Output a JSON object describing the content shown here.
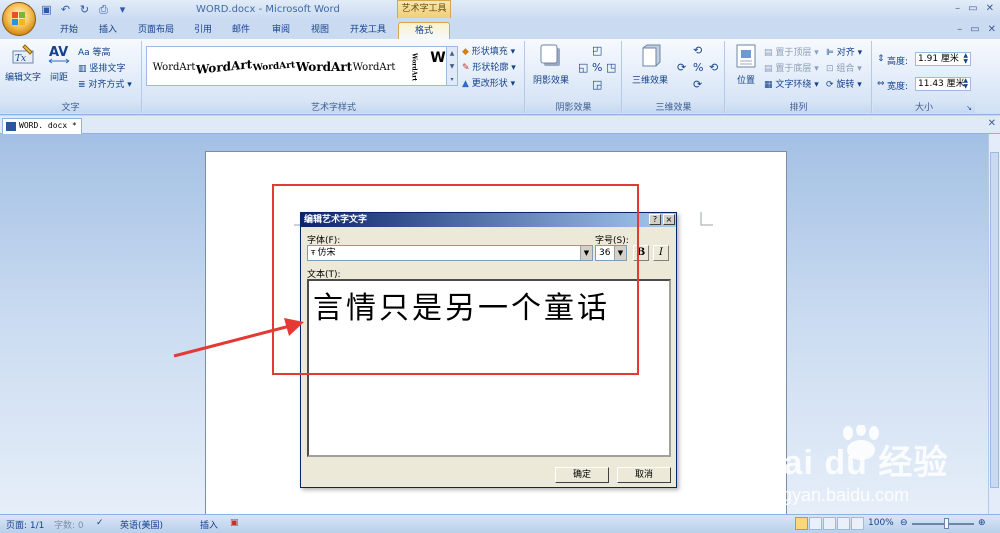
{
  "window": {
    "title": "WORD.docx - Microsoft Word",
    "context_tab_title": "艺术字工具"
  },
  "tabs": [
    "开始",
    "插入",
    "页面布局",
    "引用",
    "邮件",
    "审阅",
    "视图",
    "开发工具",
    "格式"
  ],
  "ribbon": {
    "text_group": {
      "label": "文字",
      "edit_text": "编辑文字",
      "spacing": "间距",
      "even_height": "等高",
      "vertical_text": "竖排文字",
      "align": "对齐方式"
    },
    "wordart_styles": {
      "label": "艺术字样式",
      "gallery": [
        "WordArt",
        "WordArt",
        "WordArt",
        "WordArt",
        "WordArt",
        "WordArt",
        "W"
      ],
      "shape_fill": "形状填充",
      "shape_outline": "形状轮廓",
      "change_shape": "更改形状"
    },
    "shadow": {
      "label": "阴影效果",
      "button": "阴影效果"
    },
    "threed": {
      "label": "三维效果",
      "button": "三维效果"
    },
    "arrange": {
      "label": "排列",
      "position": "位置",
      "bring_front": "置于顶层",
      "send_back": "置于底层",
      "text_wrap": "文字环绕",
      "align": "对齐",
      "group": "组合",
      "rotate": "旋转"
    },
    "size": {
      "label": "大小",
      "height_label": "高度:",
      "height_value": "1.91 厘米",
      "width_label": "宽度:",
      "width_value": "11.43 厘米"
    }
  },
  "document_tab": "WORD. docx *",
  "dialog": {
    "title": "编辑艺术字文字",
    "help": "?",
    "close": "×",
    "font_label": "字体(F):",
    "font_value": "仿宋",
    "size_label": "字号(S):",
    "size_value": "36",
    "bold": "B",
    "italic": "I",
    "text_label": "文本(T):",
    "text_value": "言情只是另一个童话",
    "ok": "确定",
    "cancel": "取消"
  },
  "watermark": {
    "brand": "Bai du 经验",
    "url": "jingyan.baidu.com"
  },
  "statusbar": {
    "page": "页面: 1/1",
    "word_count": "字数: 0",
    "language": "英语(美国)",
    "insert_mode": "插入",
    "zoom": "100%"
  },
  "colors": {
    "annotation": "#e53935",
    "ribbon_text": "#15428b",
    "dialog_title": "#0a246a"
  }
}
